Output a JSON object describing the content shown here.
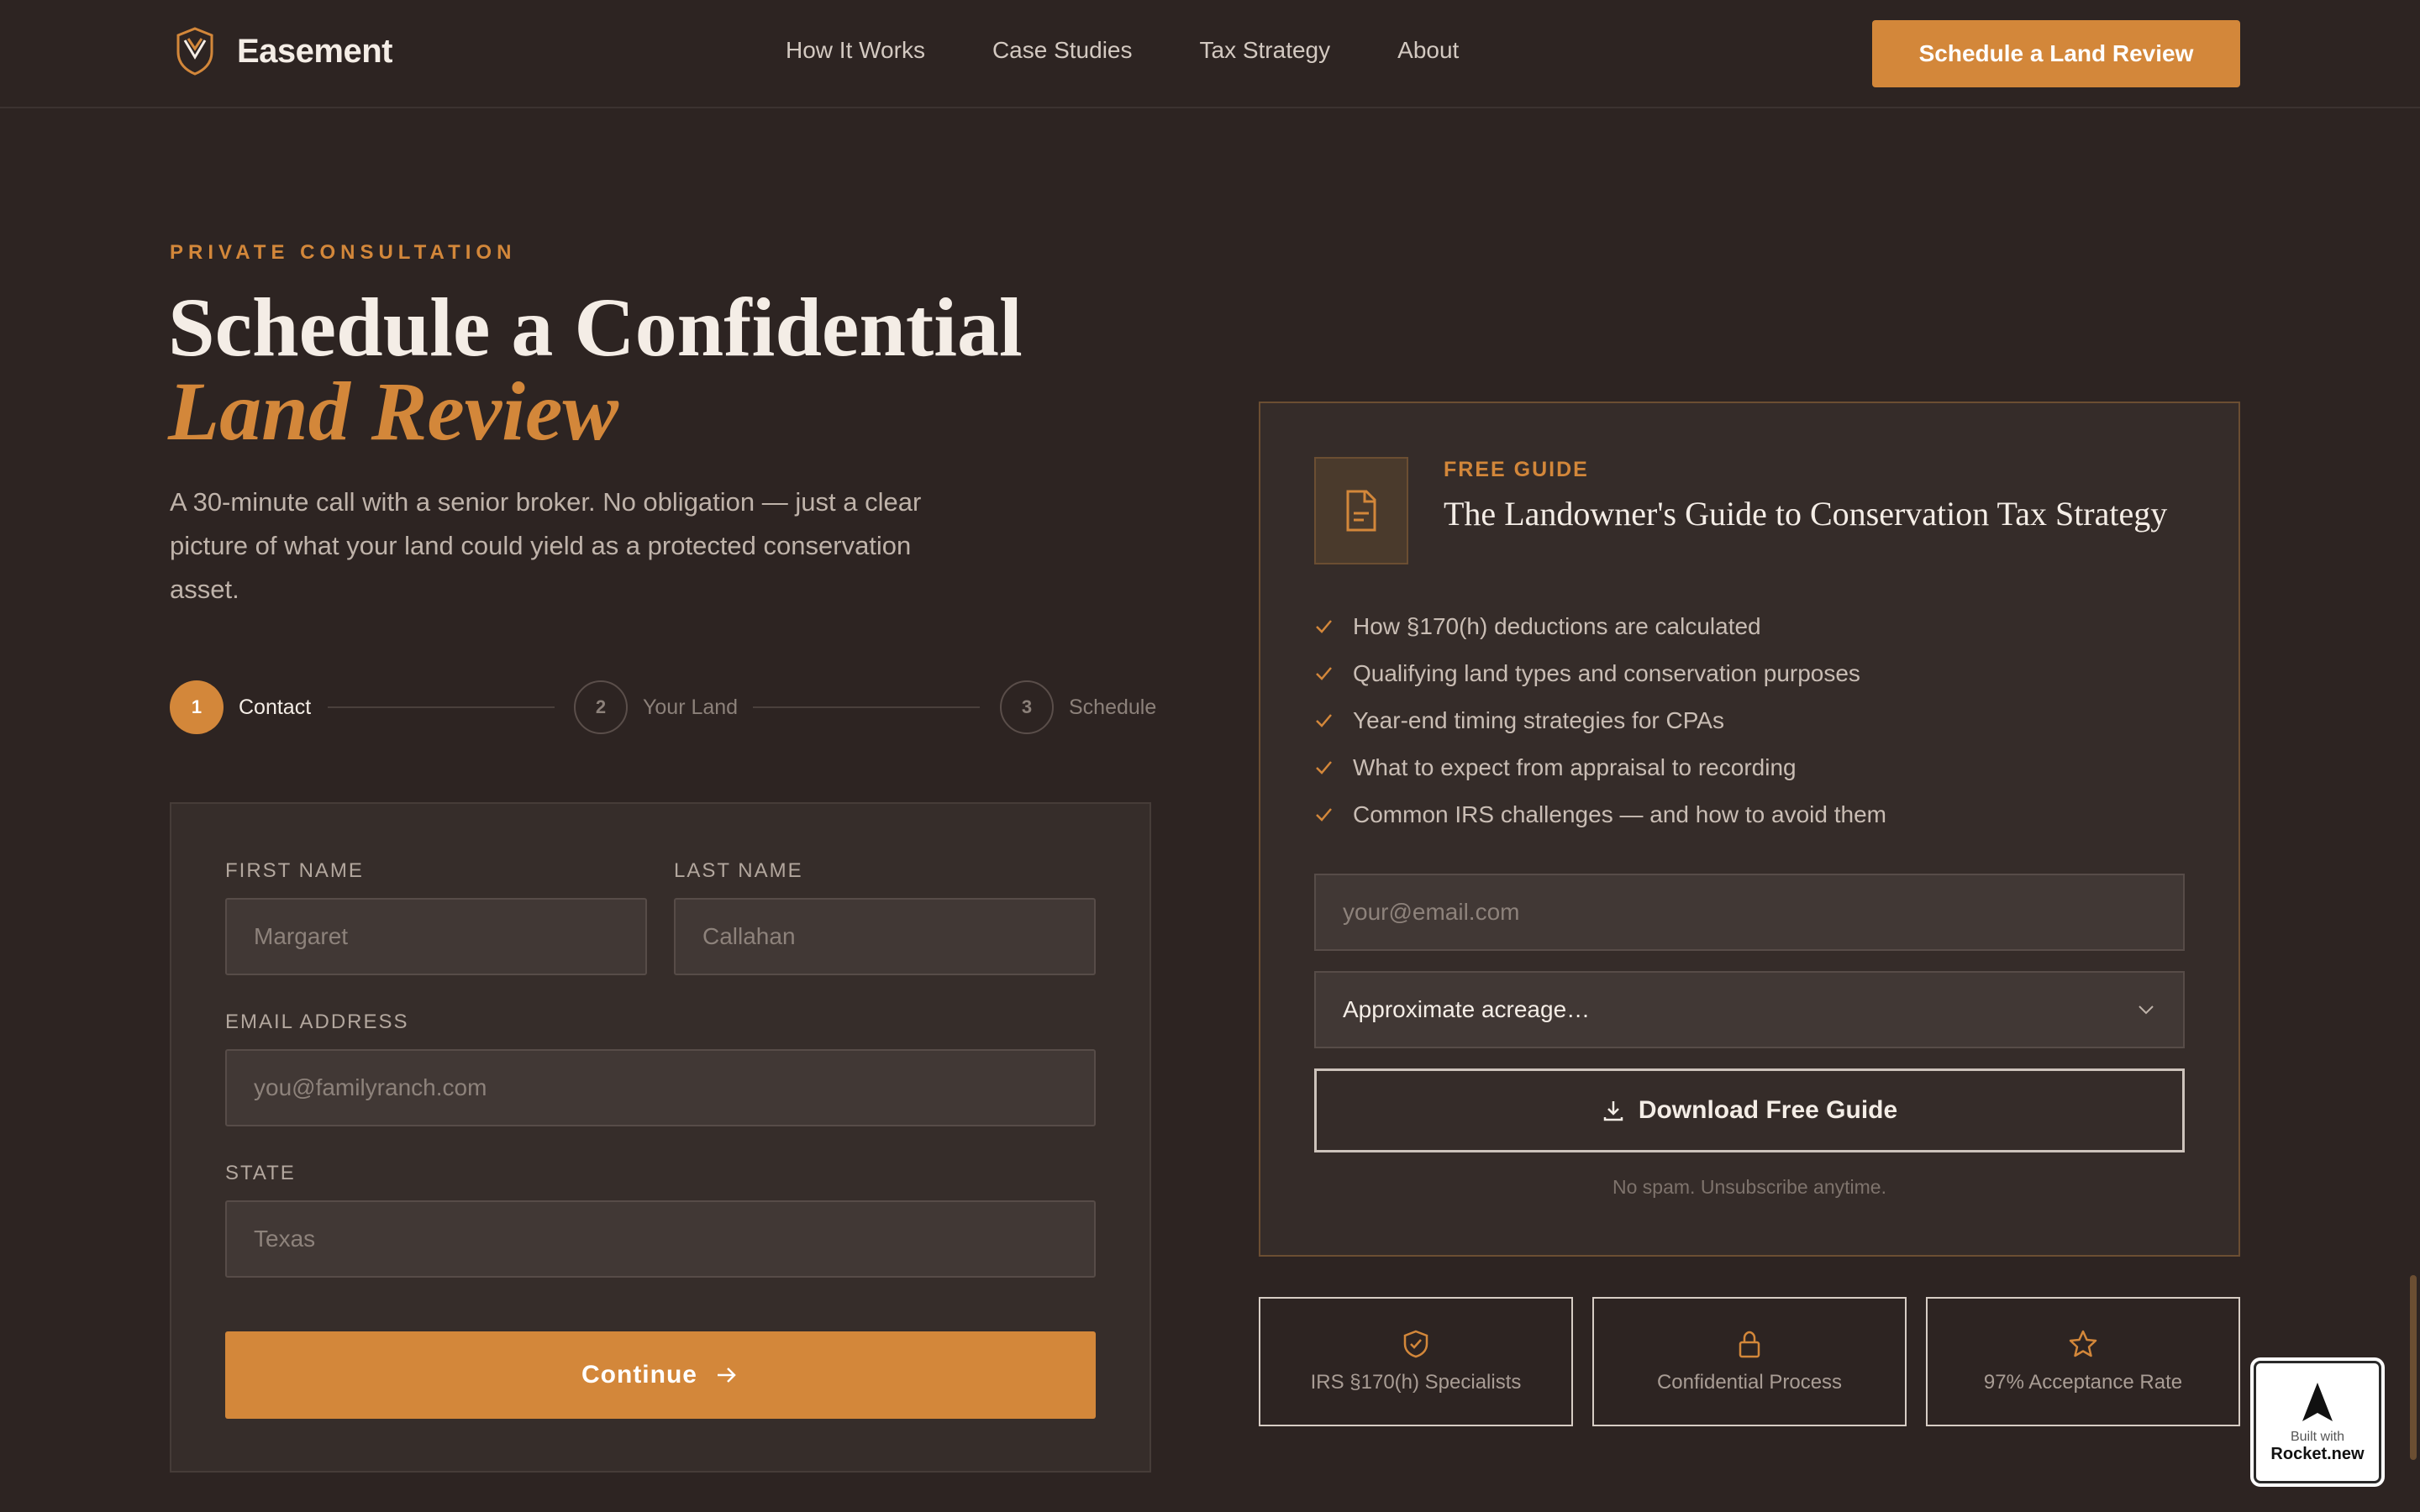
{
  "header": {
    "brand": "Easement",
    "nav": [
      "How It Works",
      "Case Studies",
      "Tax Strategy",
      "About"
    ],
    "cta": "Schedule a Land Review"
  },
  "hero": {
    "eyebrow": "PRIVATE CONSULTATION",
    "title_plain": "Schedule a Confidential ",
    "title_accent": "Land Review",
    "subtitle": "A 30-minute call with a senior broker. No obligation — just a clear picture of what your land could yield as a protected conservation asset."
  },
  "steps": [
    {
      "number": "1",
      "label": "Contact",
      "state": "active"
    },
    {
      "number": "2",
      "label": "Your Land",
      "state": "inactive"
    },
    {
      "number": "3",
      "label": "Schedule",
      "state": "inactive"
    }
  ],
  "form": {
    "first_name_label": "FIRST NAME",
    "first_name_placeholder": "Margaret",
    "last_name_label": "LAST NAME",
    "last_name_placeholder": "Callahan",
    "email_label": "EMAIL ADDRESS",
    "email_placeholder": "you@familyranch.com",
    "state_label": "STATE",
    "state_placeholder": "Texas",
    "continue_label": "Continue"
  },
  "guide": {
    "eyebrow": "FREE GUIDE",
    "title": "The Landowner's Guide to Conservation Tax Strategy",
    "benefits": [
      "How §170(h) deductions are calculated",
      "Qualifying land types and conservation purposes",
      "Year-end timing strategies for CPAs",
      "What to expect from appraisal to recording",
      "Common IRS challenges — and how to avoid them"
    ],
    "email_placeholder": "your@email.com",
    "acreage_selected": "Approximate acreage…",
    "download_label": "Download Free Guide",
    "disclaimer": "No spam. Unsubscribe anytime."
  },
  "badges": [
    {
      "icon": "shield-check-icon",
      "label": "IRS §170(h) Specialists"
    },
    {
      "icon": "lock-icon",
      "label": "Confidential Process"
    },
    {
      "icon": "star-icon",
      "label": "97% Acceptance Rate"
    }
  ],
  "rocket_badge": {
    "line1": "Built with",
    "line2": "Rocket.new"
  },
  "colors": {
    "accent": "#d3873a",
    "background": "#2d2422",
    "card": "#362d2a"
  }
}
